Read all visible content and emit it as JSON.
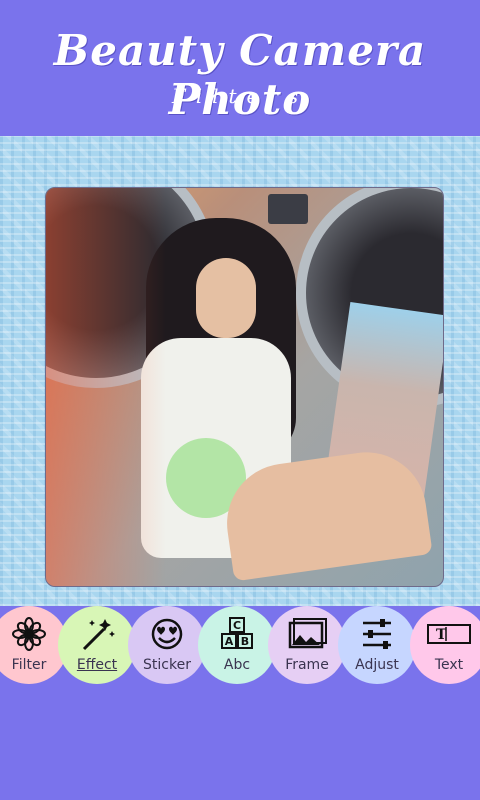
{
  "header": {
    "title": "Beauty Camera Photo",
    "subtitle": "Filters"
  },
  "toolbar": {
    "items": [
      {
        "label": "Filter",
        "icon": "flower-icon"
      },
      {
        "label": "Effect",
        "icon": "magic-wand-icon"
      },
      {
        "label": "Sticker",
        "icon": "smiley-heart-eyes-icon"
      },
      {
        "label": "Abc",
        "icon": "letter-blocks-icon"
      },
      {
        "label": "Frame",
        "icon": "picture-frame-icon"
      },
      {
        "label": "Adjust",
        "icon": "sliders-icon"
      },
      {
        "label": "Text",
        "icon": "text-box-icon"
      }
    ]
  },
  "colors": {
    "brand": "#7a73ec",
    "canvas_bg": "#a9d6ef"
  }
}
